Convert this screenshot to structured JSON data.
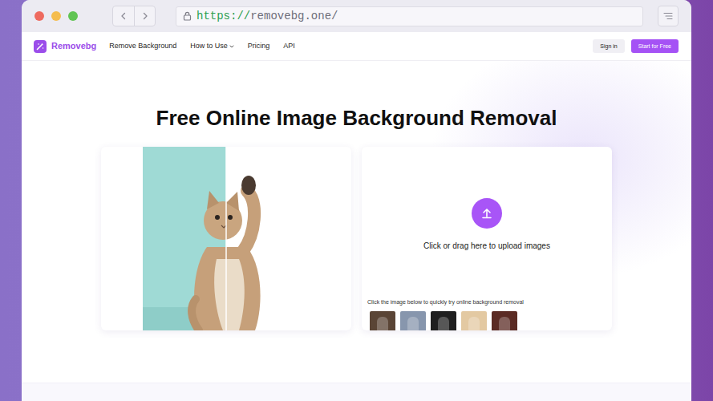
{
  "browser": {
    "traffic_lights": [
      {
        "color": "#ee6a5f"
      },
      {
        "color": "#f5bd4f"
      },
      {
        "color": "#61c454"
      }
    ],
    "url": {
      "scheme": "https://",
      "host": "removebg.one/"
    }
  },
  "navbar": {
    "brand": "Removebg",
    "links": [
      {
        "label": "Remove Background",
        "kind": "link"
      },
      {
        "label": "How to Use",
        "kind": "dropdown"
      },
      {
        "label": "Pricing",
        "kind": "link"
      },
      {
        "label": "API",
        "kind": "link"
      }
    ],
    "sign_in": "Sign in",
    "cta": "Start for Free"
  },
  "hero": {
    "title": "Free Online Image Background Removal",
    "upload_label": "Click or drag here to upload images",
    "samples_hint": "Click the image below to quickly try online background removal",
    "samples": [
      {
        "color": "#5a4536"
      },
      {
        "color": "#8796ad"
      },
      {
        "color": "#1f1f1f"
      },
      {
        "color": "#e3c9a2"
      },
      {
        "color": "#5b2b24"
      }
    ]
  }
}
